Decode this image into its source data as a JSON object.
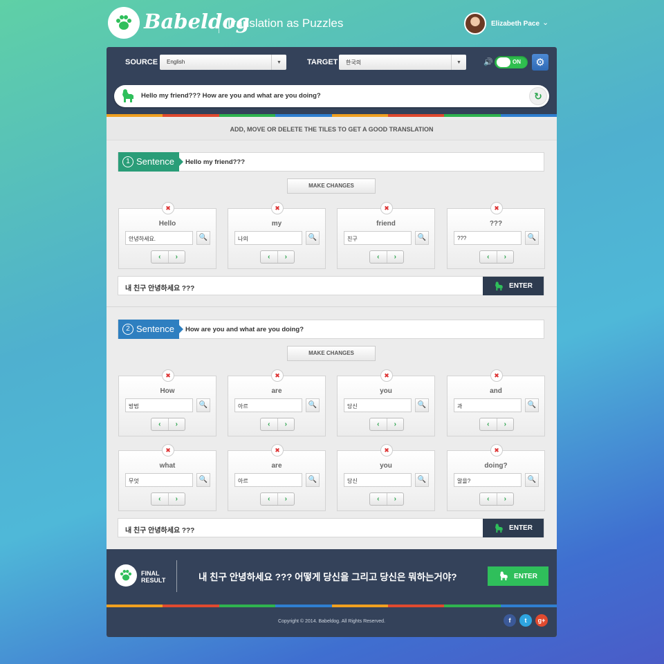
{
  "brand": {
    "name": "Babeldog",
    "tagline": "Translation as Puzzles"
  },
  "user": {
    "name": "Elizabeth Pace"
  },
  "toolbar": {
    "source_label": "SOURCE",
    "source_value": "English",
    "target_label": "TARGET",
    "target_value": "한국의",
    "toggle_label": "ON"
  },
  "input": {
    "text": "Hello my friend??? How are you and what are you doing?"
  },
  "instructions": "ADD, MOVE OR DELETE THE TILES TO GET A GOOD TRANSLATION",
  "make_changes_label": "MAKE CHANGES",
  "enter_label": "ENTER",
  "sentences": [
    {
      "num": "1",
      "label": "Sentence",
      "text": "Hello my friend???",
      "tiles": [
        {
          "word": "Hello",
          "translation": "안녕하세요."
        },
        {
          "word": "my",
          "translation": "나의"
        },
        {
          "word": "friend",
          "translation": "친구"
        },
        {
          "word": "???",
          "translation": "???"
        }
      ],
      "result": "내 친구 안녕하세요 ???"
    },
    {
      "num": "2",
      "label": "Sentence",
      "text": "How are you and what are you doing?",
      "tiles": [
        {
          "word": "How",
          "translation": "방법"
        },
        {
          "word": "are",
          "translation": "아르"
        },
        {
          "word": "you",
          "translation": "당신"
        },
        {
          "word": "and",
          "translation": "과"
        },
        {
          "word": "what",
          "translation": "무엇"
        },
        {
          "word": "are",
          "translation": "아르"
        },
        {
          "word": "you",
          "translation": "당신"
        },
        {
          "word": "doing?",
          "translation": "알을?"
        }
      ],
      "result": "내 친구 안녕하세요 ???"
    }
  ],
  "final": {
    "label_line1": "FINAL",
    "label_line2": "RESULT",
    "text": "내 친구 안녕하세요 ??? 어떻게 당신을 그리고 당신은 뭐하는거야?",
    "enter_label": "ENTER"
  },
  "footer": {
    "copyright": "Copyright © 2014. Babeldog. All Rights Reserved."
  },
  "colors": {
    "accent_green": "#2fbf5b",
    "sentence1": "#2a9d78",
    "sentence2": "#2e7fc0",
    "header_bg": "#34425a",
    "stripe": [
      "#f0a020",
      "#e04a2f",
      "#2fb34f",
      "#2f7fd0",
      "#f0a020",
      "#e04a2f",
      "#2fb34f",
      "#2f7fd0"
    ]
  },
  "icons": {
    "logo": "paw-icon",
    "input": "dog-icon",
    "refresh": "refresh-icon",
    "settings": "gear-icon",
    "speaker": "speaker-icon",
    "social": [
      "facebook-icon",
      "twitter-icon",
      "google-plus-icon"
    ]
  }
}
